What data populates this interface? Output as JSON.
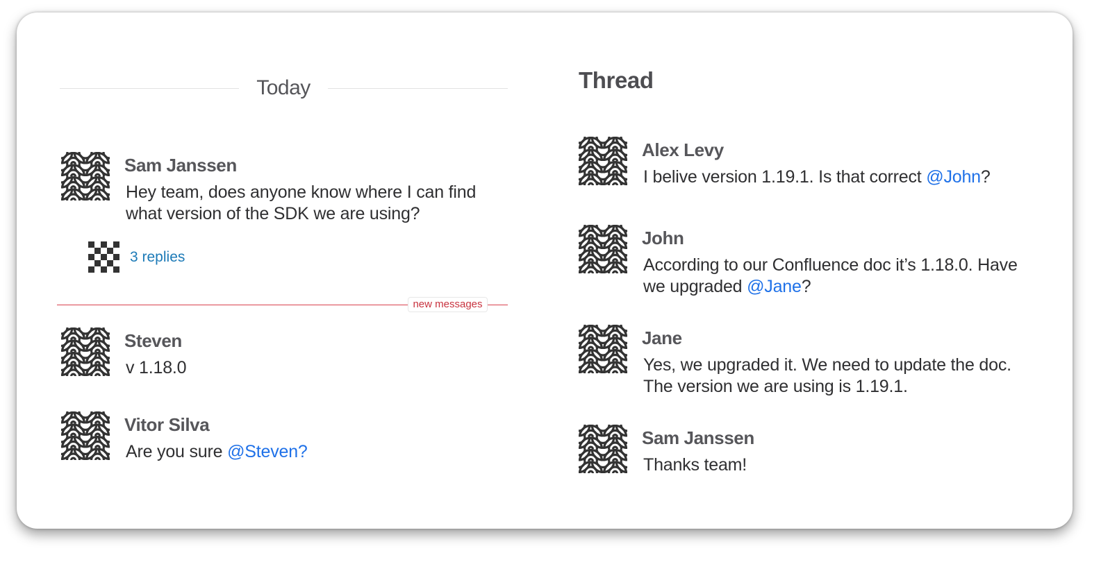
{
  "channel": {
    "day_divider": "Today",
    "new_messages_label": "new messages",
    "messages": [
      {
        "author": "Sam Janssen",
        "text_lines": [
          "Hey team, does anyone know where I can find",
          "what version of the SDK we are using?"
        ],
        "avatar": "seigaiha-wave-avatar",
        "replies_label": "3 replies",
        "replies_avatar": "checkerboard-avatar"
      },
      {
        "author": "Steven",
        "text": "v 1.18.0",
        "avatar": "seigaiha-wave-avatar"
      },
      {
        "author": "Vitor Silva",
        "text": "Are you sure ",
        "mention": "@Steven?",
        "avatar": "seigaiha-wave-avatar"
      }
    ]
  },
  "thread": {
    "title": "Thread",
    "messages": [
      {
        "author": "Alex Levy",
        "text_before": "I belive version 1.19.1. Is that correct ",
        "mention": "@John",
        "text_after": "?",
        "avatar": "seigaiha-wave-avatar"
      },
      {
        "author": "John",
        "line1": "According to our Confluence doc it’s 1.18.0. Have",
        "line2_before": "we upgraded ",
        "mention": "@Jane",
        "line2_after": "?",
        "avatar": "seigaiha-wave-avatar"
      },
      {
        "author": "Jane",
        "text_lines": [
          "Yes, we upgraded it. We need to update the doc.",
          "The version we are using is 1.19.1."
        ],
        "avatar": "seigaiha-wave-avatar"
      },
      {
        "author": "Sam Janssen",
        "text": "Thanks team!",
        "avatar": "seigaiha-wave-avatar"
      }
    ]
  },
  "colors": {
    "mention": "#1f71e8",
    "replies_link": "#1c7ab7",
    "new_messages": "#d9414d",
    "author": "#56565a"
  }
}
